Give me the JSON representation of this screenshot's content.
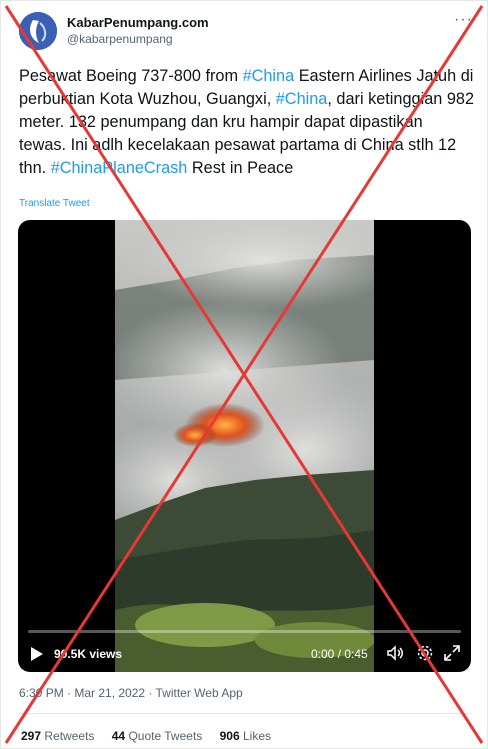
{
  "account": {
    "name": "KabarPenumpang.com",
    "handle": "@kabarpenumpang"
  },
  "tweet": {
    "text_parts": [
      {
        "text": "Pesawat Boeing 737-800 from ",
        "hashtag": false
      },
      {
        "text": "#China",
        "hashtag": true
      },
      {
        "text": " Eastern Airlines Jatuh di perbuktian Kota Wuzhou, Guangxi, ",
        "hashtag": false
      },
      {
        "text": "#China",
        "hashtag": true
      },
      {
        "text": ", dari ketinggian 982 meter. 132 penumpang dan kru hampir dapat dipastikan tewas.  Ini adlh kecelakaan pesawat partama di China stlh 12 thn. ",
        "hashtag": false
      },
      {
        "text": "#ChinaPlaneCrash",
        "hashtag": true
      },
      {
        "text": " Rest in Peace",
        "hashtag": false
      }
    ],
    "translate_label": "Translate Tweet"
  },
  "video": {
    "views": "90.5K views",
    "time": "0:00 / 0:45",
    "progress": 0
  },
  "meta": {
    "timestamp": "6:30 PM · Mar 21, 2022 · Twitter Web App"
  },
  "stats": {
    "retweets_count": "297",
    "retweets_label": "Retweets",
    "quotes_count": "44",
    "quotes_label": "Quote Tweets",
    "likes_count": "906",
    "likes_label": "Likes"
  },
  "colors": {
    "link": "#1d9bf0",
    "cross": "#e53935"
  },
  "icons": [
    "more-icon",
    "play-icon",
    "volume-icon",
    "settings-icon",
    "fullscreen-icon"
  ]
}
